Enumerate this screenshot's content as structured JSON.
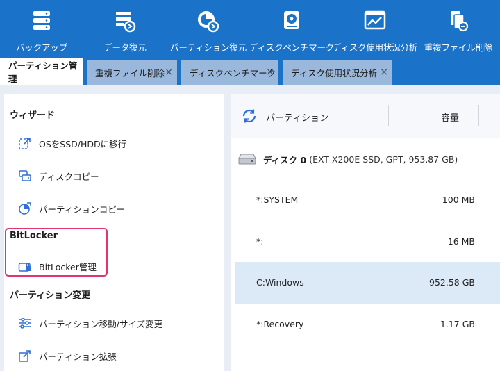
{
  "toolbar": {
    "items": [
      {
        "label": "バックアップ",
        "icon": "database-icon"
      },
      {
        "label": "データ復元",
        "icon": "data-restore-icon"
      },
      {
        "label": "パーティション復元",
        "icon": "partition-restore-icon"
      },
      {
        "label": "ディスクベンチマーク",
        "icon": "benchmark-icon"
      },
      {
        "label": "ディスク使用状況分析",
        "icon": "chart-icon"
      },
      {
        "label": "重複ファイル削除",
        "icon": "duplicate-file-icon"
      }
    ]
  },
  "tabs": [
    {
      "label": "パーティション管理",
      "active": true
    },
    {
      "label": "重複ファイル削除",
      "close": "×"
    },
    {
      "label": "ディスクベンチマーク",
      "close": "×"
    },
    {
      "label": "ディスク使用状況分析",
      "close": "×"
    }
  ],
  "sidebar": {
    "wizard": {
      "title": "ウィザード",
      "items": [
        {
          "label": "OSをSSD/HDDに移行",
          "icon": "migrate-icon"
        },
        {
          "label": "ディスクコピー",
          "icon": "disk-copy-icon"
        },
        {
          "label": "パーティションコピー",
          "icon": "partition-copy-icon"
        }
      ]
    },
    "bitlocker": {
      "title": "BitLocker",
      "items": [
        {
          "label": "BitLocker管理",
          "icon": "lock-drive-icon"
        }
      ]
    },
    "change": {
      "title": "パーティション変更",
      "items": [
        {
          "label": "パーティション移動/サイズ変更",
          "icon": "sliders-icon"
        },
        {
          "label": "パーティション拡張",
          "icon": "extend-icon"
        }
      ]
    }
  },
  "table": {
    "col_partition": "パーティション",
    "col_capacity": "容量",
    "disk_name": "ディスク 0",
    "disk_info": "(EXT X200E SSD, GPT, 953.87 GB)",
    "rows": [
      {
        "name": "*:SYSTEM",
        "capacity": "100 MB"
      },
      {
        "name": "*:",
        "capacity": "16 MB"
      },
      {
        "name": "C:Windows",
        "capacity": "952.58 GB",
        "selected": true
      },
      {
        "name": "*:Recovery",
        "capacity": "1.17 GB"
      }
    ]
  },
  "colors": {
    "toolbar_bg": "#1a73c9",
    "tab_inactive_bg": "#9ab8dc",
    "selected_row_bg": "#dce9f7",
    "highlight_box": "#e0356e",
    "icon_blue": "#2f6fd6"
  }
}
